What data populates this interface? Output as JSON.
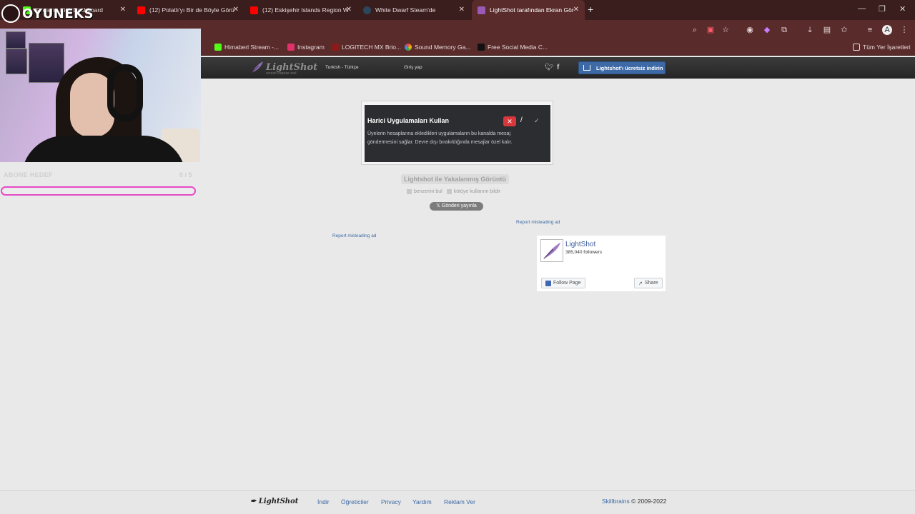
{
  "browser": {
    "tabs": [
      {
        "title": "Stream - Kick Dashboard",
        "icon": "kick-icon",
        "color": "#53fc18",
        "active": false
      },
      {
        "title": "(12) Polatlı'yı Bir de Böyle Görü",
        "icon": "youtube-icon",
        "color": "#ff0000",
        "active": false
      },
      {
        "title": "(12) Eskişehir Islands Region W",
        "icon": "youtube-icon",
        "color": "#ff0000",
        "active": false
      },
      {
        "title": "White Dwarf Steam'de",
        "icon": "steam-icon",
        "color": "#1b2838",
        "active": false
      },
      {
        "title": "LightShot tarafından Ekran Gör",
        "icon": "lightshot-icon",
        "color": "#9b59b6",
        "active": true
      }
    ],
    "bookmarks": [
      {
        "label": "Himaberl Stream -...",
        "icon": "kick-icon",
        "color": "#53fc18"
      },
      {
        "label": "Instagram",
        "icon": "instagram-icon",
        "color": "#e1306c"
      },
      {
        "label": "LOGITECH MX Brio...",
        "icon": "logitech-icon",
        "color": "#8b1a1a"
      },
      {
        "label": "Sound Memory Ga...",
        "icon": "chrome-icon",
        "color": "#4caf50"
      },
      {
        "label": "Free Social Media C...",
        "icon": "vp-icon",
        "color": "#111111"
      }
    ],
    "all_bookmarks_label": "Tüm Yer İşaretleri"
  },
  "overlay": {
    "brand": "OYUNEKS",
    "goal_label": "ABONE HEDEF",
    "goal_count": "0 / 5",
    "goal_progress": 0.0,
    "accent_color": "#e64bc7"
  },
  "lightshot": {
    "logo_text": "LightShot",
    "logo_sub": "screen capture tool",
    "language": "Turkish - Türkçe",
    "login": "Giriş yap",
    "download_label": "Lightshot'ı ücretsiz indirin",
    "screenshot": {
      "title": "Harici Uygulamaları Kullan",
      "description": "Üyelerin hesaplarına ekledikleri uygulamaların bu kanalda mesaj göndermesini sağlar. Devre dışı bırakıldığında mesajlar özel kalır.",
      "close_symbol": "✕",
      "slash_symbol": "/",
      "check_symbol": "✓"
    },
    "caption": "Lightshot ile Yakalanmış Görüntü",
    "similar_label": "benzerini bul",
    "report_abuse_label": "kötüye kullanım bildir",
    "tweet_label": "Gönderi yayınla",
    "report_ad_right": "Report misleading ad",
    "report_ad_left": "Report misleading ad",
    "facebook": {
      "page_name": "LightShot",
      "followers": "385,040 followers",
      "follow_label": "Follow Page",
      "share_label": "Share"
    },
    "footer": {
      "logo": "LightShot",
      "links": [
        "İndir",
        "Öğreticiler",
        "Privacy",
        "Yardım",
        "Reklam Ver"
      ],
      "copyright_brand": "Skillbrains",
      "copyright_rest": " © 2009-2022"
    }
  }
}
